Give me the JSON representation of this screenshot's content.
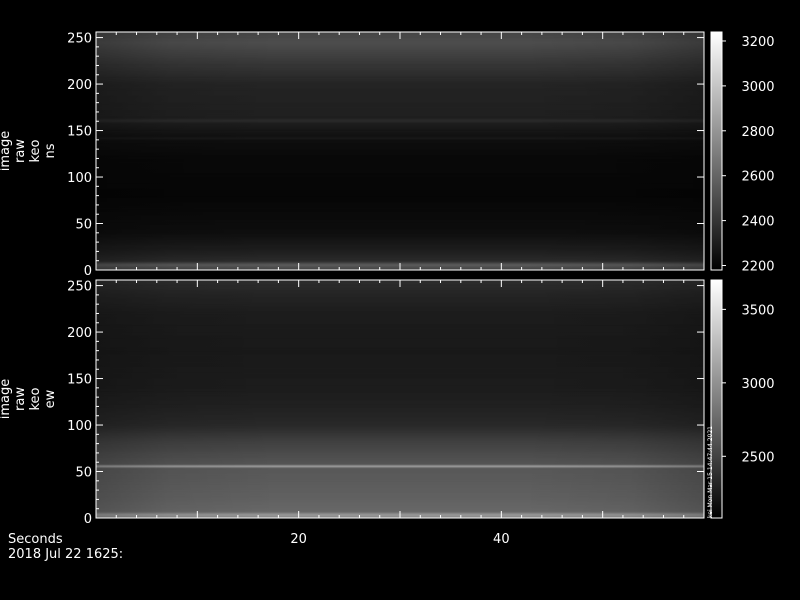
{
  "chart_data": [
    {
      "type": "heatmap",
      "ylabel": [
        "image",
        "raw",
        "keo",
        "ns"
      ],
      "yticks": [
        0,
        50,
        100,
        150,
        200,
        250
      ],
      "ylim": [
        0,
        256
      ],
      "xlim": [
        0,
        60
      ],
      "color_scale": {
        "min": 2180,
        "max": 3240,
        "ticks": [
          2200,
          2400,
          2600,
          2800,
          3000,
          3200
        ],
        "colormap": "grayscale"
      },
      "row_profile": [
        {
          "y": 0,
          "v": 2440
        },
        {
          "y": 3,
          "v": 2500
        },
        {
          "y": 6,
          "v": 2560
        },
        {
          "y": 10,
          "v": 2360
        },
        {
          "y": 20,
          "v": 2310
        },
        {
          "y": 40,
          "v": 2240
        },
        {
          "y": 80,
          "v": 2205
        },
        {
          "y": 120,
          "v": 2215
        },
        {
          "y": 140,
          "v": 2240
        },
        {
          "y": 142,
          "v": 2290
        },
        {
          "y": 144,
          "v": 2250
        },
        {
          "y": 158,
          "v": 2300
        },
        {
          "y": 161,
          "v": 2360
        },
        {
          "y": 164,
          "v": 2310
        },
        {
          "y": 200,
          "v": 2330
        },
        {
          "y": 220,
          "v": 2400
        },
        {
          "y": 235,
          "v": 2460
        },
        {
          "y": 245,
          "v": 2500
        },
        {
          "y": 256,
          "v": 2470
        }
      ],
      "edge_darkening": 0.12
    },
    {
      "type": "heatmap",
      "ylabel": [
        "image",
        "raw",
        "keo",
        "ew"
      ],
      "yticks": [
        0,
        50,
        100,
        150,
        200,
        250
      ],
      "ylim": [
        0,
        256
      ],
      "xlim": [
        0,
        60
      ],
      "color_scale": {
        "min": 2080,
        "max": 3700,
        "ticks": [
          2500,
          3000,
          3500
        ],
        "colormap": "grayscale"
      },
      "row_profile": [
        {
          "y": 0,
          "v": 2900
        },
        {
          "y": 4,
          "v": 3050
        },
        {
          "y": 7,
          "v": 2740
        },
        {
          "y": 20,
          "v": 2700
        },
        {
          "y": 40,
          "v": 2660
        },
        {
          "y": 54,
          "v": 2640
        },
        {
          "y": 56,
          "v": 3150
        },
        {
          "y": 58,
          "v": 2620
        },
        {
          "y": 70,
          "v": 2560
        },
        {
          "y": 85,
          "v": 2470
        },
        {
          "y": 100,
          "v": 2340
        },
        {
          "y": 120,
          "v": 2290
        },
        {
          "y": 140,
          "v": 2260
        },
        {
          "y": 180,
          "v": 2240
        },
        {
          "y": 220,
          "v": 2260
        },
        {
          "y": 240,
          "v": 2310
        },
        {
          "y": 256,
          "v": 2370
        }
      ],
      "edge_darkening": 0.1,
      "side_annotation": "kei Mon Mar 15 14:47:44 2021"
    }
  ],
  "shared_x": {
    "label": "Seconds",
    "ticks": [
      20,
      40
    ],
    "date_label": "2018 Jul 22 1625:"
  }
}
